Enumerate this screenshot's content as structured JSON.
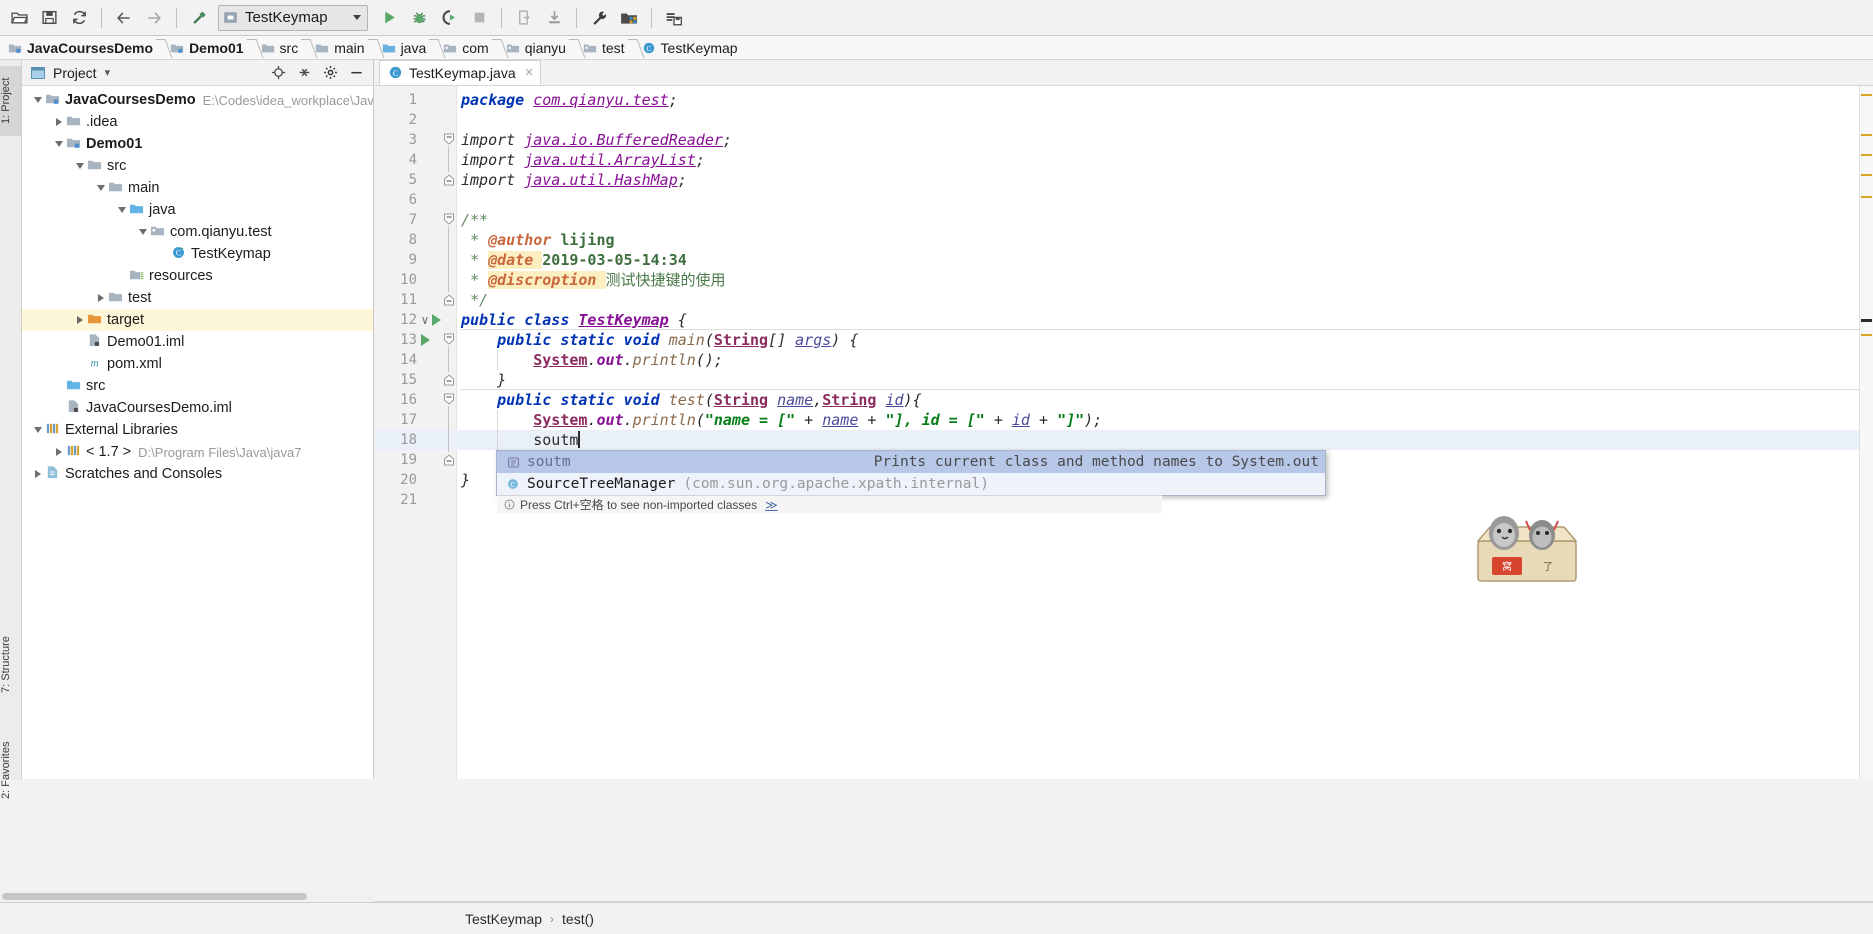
{
  "toolbar": {
    "buttons": [
      {
        "name": "open-folder-icon",
        "icon": "folder-open"
      },
      {
        "name": "save-all-icon",
        "icon": "save"
      },
      {
        "name": "sync-icon",
        "icon": "refresh"
      },
      {
        "name": "back-icon",
        "icon": "arrow-left"
      },
      {
        "name": "forward-icon",
        "icon": "arrow-right"
      },
      {
        "name": "build-hammer-icon",
        "icon": "hammer"
      }
    ],
    "run_config": {
      "label": "TestKeymap",
      "dropdown": "chevron-down"
    },
    "run_buttons": [
      {
        "name": "run-icon",
        "icon": "play"
      },
      {
        "name": "debug-icon",
        "icon": "bug"
      },
      {
        "name": "run-with-coverage-icon",
        "icon": "coverage"
      },
      {
        "name": "stop-icon",
        "icon": "stop"
      }
    ],
    "right_buttons": [
      {
        "name": "update-application-icon",
        "icon": "update-app"
      },
      {
        "name": "install-icon",
        "icon": "install"
      },
      {
        "name": "settings-wrench-icon",
        "icon": "wrench"
      },
      {
        "name": "project-structure-icon",
        "icon": "project-structure"
      },
      {
        "name": "search-everywhere-icon",
        "icon": "db-save"
      }
    ]
  },
  "breadcrumb": {
    "items": [
      {
        "label": "JavaCoursesDemo",
        "icon": "module-icon",
        "bold": true
      },
      {
        "label": "Demo01",
        "icon": "module-icon",
        "bold": true
      },
      {
        "label": "src",
        "icon": "folder-icon",
        "bold": false
      },
      {
        "label": "main",
        "icon": "folder-icon",
        "bold": false
      },
      {
        "label": "java",
        "icon": "source-folder-icon",
        "bold": false
      },
      {
        "label": "com",
        "icon": "package-icon",
        "bold": false
      },
      {
        "label": "qianyu",
        "icon": "package-icon",
        "bold": false
      },
      {
        "label": "test",
        "icon": "package-icon",
        "bold": false
      },
      {
        "label": "TestKeymap",
        "icon": "java-class-icon",
        "bold": false
      }
    ]
  },
  "left_rail": {
    "project_tab": "1: Project",
    "structure_tab": "7: Structure",
    "favorites_tab": "2: Favorites"
  },
  "project_panel": {
    "title": "Project",
    "title_caret": "▾",
    "header_actions": [
      {
        "name": "locate-target-icon",
        "icon": "target"
      },
      {
        "name": "collapse-all-icon",
        "icon": "collapse"
      },
      {
        "name": "settings-gear-icon",
        "icon": "gear"
      },
      {
        "name": "hide-panel-icon",
        "icon": "minus"
      }
    ],
    "tree": [
      {
        "depth": 0,
        "twisty": "down",
        "icon": "project-root-icon",
        "label": "JavaCoursesDemo",
        "bold": true,
        "path": "E:\\Codes\\idea_workplace\\JavaCo",
        "highlight": false
      },
      {
        "depth": 1,
        "twisty": "right",
        "icon": "folder-icon",
        "label": ".idea",
        "bold": false,
        "path": "",
        "highlight": false
      },
      {
        "depth": 1,
        "twisty": "down",
        "icon": "module-icon",
        "label": "Demo01",
        "bold": true,
        "path": "",
        "highlight": false
      },
      {
        "depth": 2,
        "twisty": "down",
        "icon": "folder-icon",
        "label": "src",
        "bold": false,
        "path": "",
        "highlight": false
      },
      {
        "depth": 3,
        "twisty": "down",
        "icon": "folder-icon",
        "label": "main",
        "bold": false,
        "path": "",
        "highlight": false
      },
      {
        "depth": 4,
        "twisty": "down",
        "icon": "source-folder-icon",
        "label": "java",
        "bold": false,
        "path": "",
        "highlight": false
      },
      {
        "depth": 5,
        "twisty": "down",
        "icon": "package-icon",
        "label": "com.qianyu.test",
        "bold": false,
        "path": "",
        "highlight": false
      },
      {
        "depth": 6,
        "twisty": "none",
        "icon": "java-class-icon",
        "label": "TestKeymap",
        "bold": false,
        "path": "",
        "highlight": false
      },
      {
        "depth": 4,
        "twisty": "none",
        "icon": "resources-icon",
        "label": "resources",
        "bold": false,
        "path": "",
        "highlight": false
      },
      {
        "depth": 3,
        "twisty": "right",
        "icon": "folder-icon",
        "label": "test",
        "bold": false,
        "path": "",
        "highlight": false
      },
      {
        "depth": 2,
        "twisty": "right",
        "icon": "excluded-folder-icon",
        "label": "target",
        "bold": false,
        "path": "",
        "highlight": true
      },
      {
        "depth": 2,
        "twisty": "none",
        "icon": "iml-icon",
        "label": "Demo01.iml",
        "bold": false,
        "path": "",
        "highlight": false
      },
      {
        "depth": 2,
        "twisty": "none",
        "icon": "maven-icon",
        "label": "pom.xml",
        "bold": false,
        "path": "",
        "highlight": false
      },
      {
        "depth": 1,
        "twisty": "none",
        "icon": "source-folder-icon",
        "label": "src",
        "bold": false,
        "path": "",
        "highlight": false
      },
      {
        "depth": 1,
        "twisty": "none",
        "icon": "iml-icon",
        "label": "JavaCoursesDemo.iml",
        "bold": false,
        "path": "",
        "highlight": false
      },
      {
        "depth": 0,
        "twisty": "down",
        "icon": "libraries-icon",
        "label": "External Libraries",
        "bold": false,
        "path": "",
        "highlight": false
      },
      {
        "depth": 1,
        "twisty": "right",
        "icon": "jdk-icon",
        "label": "< 1.7 >",
        "bold": false,
        "path": "D:\\Program Files\\Java\\java7",
        "highlight": false
      },
      {
        "depth": 0,
        "twisty": "right",
        "icon": "scratch-icon",
        "label": "Scratches and Consoles",
        "bold": false,
        "path": "",
        "highlight": false
      }
    ]
  },
  "editor": {
    "tab": {
      "label": "TestKeymap.java",
      "icon": "java-class-icon",
      "close": "×"
    },
    "line_numbers": [
      "1",
      "2",
      "3",
      "4",
      "5",
      "6",
      "7",
      "8",
      "9",
      "10",
      "11",
      "12",
      "13",
      "14",
      "15",
      "16",
      "17",
      "18",
      "19",
      "20",
      "21"
    ],
    "code_lines": [
      {
        "n": 1,
        "fold": "none",
        "run": false,
        "text": "package com.qianyu.test;"
      },
      {
        "n": 2,
        "fold": "none",
        "run": false,
        "text": ""
      },
      {
        "n": 3,
        "fold": "open",
        "run": false,
        "text": "import java.io.BufferedReader;"
      },
      {
        "n": 4,
        "fold": "none",
        "run": false,
        "text": "import java.util.ArrayList;"
      },
      {
        "n": 5,
        "fold": "close",
        "run": false,
        "text": "import java.util.HashMap;"
      },
      {
        "n": 6,
        "fold": "none",
        "run": false,
        "text": ""
      },
      {
        "n": 7,
        "fold": "open",
        "run": false,
        "text": "/**"
      },
      {
        "n": 8,
        "fold": "none",
        "run": false,
        "text": " * @author lijing"
      },
      {
        "n": 9,
        "fold": "none",
        "run": false,
        "text": " * @date 2019-03-05-14:34"
      },
      {
        "n": 10,
        "fold": "none",
        "run": false,
        "text": " * @discroption 测试快捷键的使用"
      },
      {
        "n": 11,
        "fold": "close",
        "run": false,
        "text": " */"
      },
      {
        "n": 12,
        "fold": "none",
        "run": true,
        "text": "public class TestKeymap {"
      },
      {
        "n": 13,
        "fold": "open",
        "run": true,
        "text": "    public static void main(String[] args) {"
      },
      {
        "n": 14,
        "fold": "none",
        "run": false,
        "text": "        System.out.println();"
      },
      {
        "n": 15,
        "fold": "close",
        "run": false,
        "text": "    }"
      },
      {
        "n": 16,
        "fold": "open",
        "run": false,
        "text": "    public static void test(String name,String id){"
      },
      {
        "n": 17,
        "fold": "none",
        "run": false,
        "text": "        System.out.println(\"name = [\" + name + \"], id = [\" + id + \"]\");"
      },
      {
        "n": 18,
        "fold": "none",
        "run": false,
        "text": "        soutm",
        "current": true
      },
      {
        "n": 19,
        "fold": "close",
        "run": false,
        "text": "    }"
      },
      {
        "n": 20,
        "fold": "none",
        "run": false,
        "text": "}"
      },
      {
        "n": 21,
        "fold": "none",
        "run": false,
        "text": ""
      }
    ]
  },
  "autocomplete": {
    "items": [
      {
        "selected": true,
        "icon": "live-template-icon",
        "name": "soutm",
        "package": "",
        "hint": "Prints current class and method names to System.out"
      },
      {
        "selected": false,
        "icon": "class-icon",
        "name": "SourceTreeManager",
        "package": "(com.sun.org.apache.xpath.internal)",
        "hint": ""
      }
    ],
    "footer": {
      "text": "Press Ctrl+空格 to see non-imported classes",
      "more": "≫"
    }
  },
  "status": {
    "nav_class": "TestKeymap",
    "nav_separator": "›",
    "nav_method": "test()"
  },
  "colors": {
    "accent_green": "#59a869",
    "keyword_blue": "#0033b3",
    "string_green": "#067d17",
    "class_purple": "#871094",
    "comment_green": "#5f8c5f",
    "current_line": "#e9f0f7",
    "selection_blue": "#b6c7e8",
    "highlight_yellow": "#fdf6d8"
  }
}
